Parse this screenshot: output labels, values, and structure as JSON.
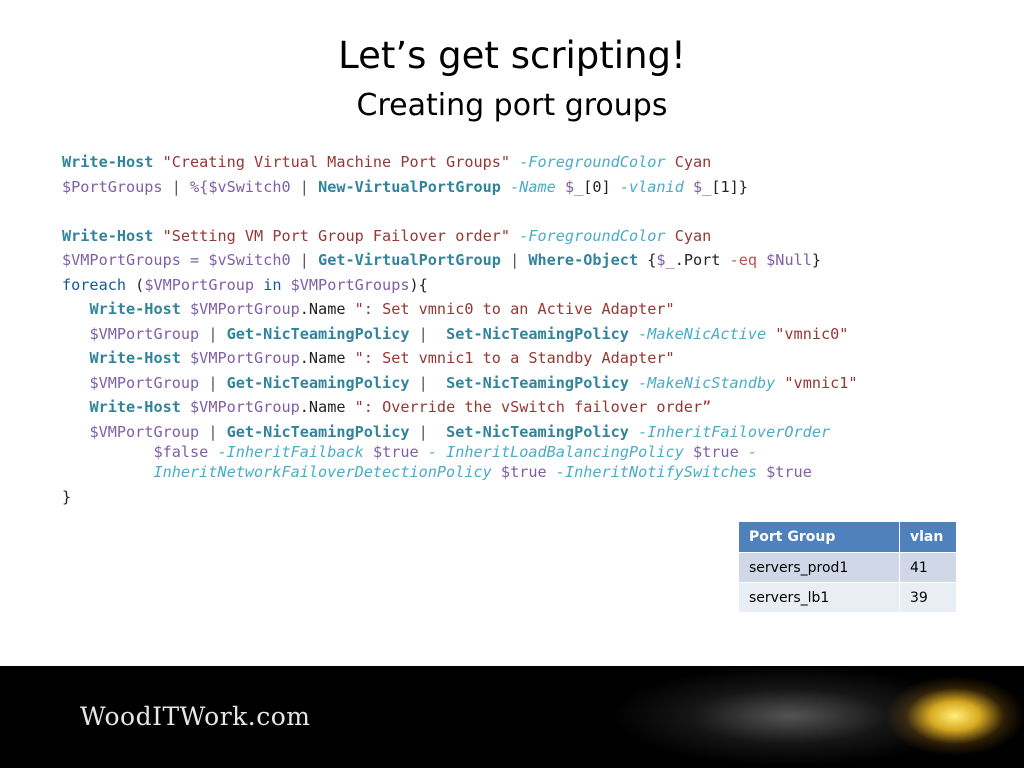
{
  "slide": {
    "title": "Let’s get scripting!",
    "subtitle": "Creating port groups"
  },
  "code": {
    "lines": [
      [
        [
          "cmd",
          "Write-Host"
        ],
        [
          "plain",
          " "
        ],
        [
          "str",
          "\"Creating Virtual Machine Port Groups\""
        ],
        [
          "plain",
          " "
        ],
        [
          "par",
          "-ForegroundColor"
        ],
        [
          "plain",
          " "
        ],
        [
          "str",
          "Cyan"
        ]
      ],
      [
        [
          "var",
          "$PortGroups"
        ],
        [
          "op",
          " | "
        ],
        [
          "var",
          "%{"
        ],
        [
          "var",
          "$vSwitch0"
        ],
        [
          "op",
          " | "
        ],
        [
          "cmd",
          "New-VirtualPortGroup"
        ],
        [
          "plain",
          " "
        ],
        [
          "par",
          "-Name"
        ],
        [
          "plain",
          " "
        ],
        [
          "var",
          "$_"
        ],
        [
          "plain",
          "[0] "
        ],
        [
          "par",
          "-vlanid"
        ],
        [
          "plain",
          " "
        ],
        [
          "var",
          "$_"
        ],
        [
          "plain",
          "[1]}"
        ]
      ],
      [],
      [
        [
          "cmd",
          "Write-Host"
        ],
        [
          "plain",
          " "
        ],
        [
          "str",
          "\"Setting VM Port Group Failover order\""
        ],
        [
          "plain",
          " "
        ],
        [
          "par",
          "-ForegroundColor"
        ],
        [
          "plain",
          " "
        ],
        [
          "str",
          "Cyan"
        ]
      ],
      [
        [
          "var",
          "$VMPortGroups"
        ],
        [
          "var",
          " = "
        ],
        [
          "var",
          "$vSwitch0"
        ],
        [
          "op",
          " | "
        ],
        [
          "cmd",
          "Get-VirtualPortGroup"
        ],
        [
          "op",
          " | "
        ],
        [
          "cmd",
          "Where-Object"
        ],
        [
          "plain",
          " {"
        ],
        [
          "var",
          "$_"
        ],
        [
          "plain",
          ".Port "
        ],
        [
          "red",
          "-eq"
        ],
        [
          "plain",
          " "
        ],
        [
          "var",
          "$Null"
        ],
        [
          "plain",
          "}"
        ]
      ],
      [
        [
          "kw",
          "foreach"
        ],
        [
          "plain",
          " ("
        ],
        [
          "var",
          "$VMPortGroup"
        ],
        [
          "kw",
          " in "
        ],
        [
          "var",
          "$VMPortGroups"
        ],
        [
          "plain",
          "){"
        ]
      ],
      [
        [
          "plain",
          "   "
        ],
        [
          "cmd",
          "Write-Host"
        ],
        [
          "plain",
          " "
        ],
        [
          "var",
          "$VMPortGroup"
        ],
        [
          "plain",
          ".Name "
        ],
        [
          "str",
          "\": Set vmnic0 to an Active Adapter\""
        ]
      ],
      [
        [
          "plain",
          "   "
        ],
        [
          "var",
          "$VMPortGroup"
        ],
        [
          "op",
          " | "
        ],
        [
          "cmd",
          "Get-NicTeamingPolicy"
        ],
        [
          "op",
          " |  "
        ],
        [
          "cmd",
          "Set-NicTeamingPolicy"
        ],
        [
          "plain",
          " "
        ],
        [
          "par",
          "-MakeNicActive"
        ],
        [
          "plain",
          " "
        ],
        [
          "str",
          "\"vmnic0\""
        ]
      ],
      [
        [
          "plain",
          "   "
        ],
        [
          "cmd",
          "Write-Host"
        ],
        [
          "plain",
          " "
        ],
        [
          "var",
          "$VMPortGroup"
        ],
        [
          "plain",
          ".Name "
        ],
        [
          "str",
          "\": Set vmnic1 to a Standby Adapter\""
        ]
      ],
      [
        [
          "plain",
          "   "
        ],
        [
          "var",
          "$VMPortGroup"
        ],
        [
          "op",
          " | "
        ],
        [
          "cmd",
          "Get-NicTeamingPolicy"
        ],
        [
          "op",
          " |  "
        ],
        [
          "cmd",
          "Set-NicTeamingPolicy"
        ],
        [
          "plain",
          " "
        ],
        [
          "par",
          "-MakeNicStandby"
        ],
        [
          "plain",
          " "
        ],
        [
          "str",
          "\"vmnic1\""
        ]
      ],
      [
        [
          "plain",
          "   "
        ],
        [
          "cmd",
          "Write-Host"
        ],
        [
          "plain",
          " "
        ],
        [
          "var",
          "$VMPortGroup"
        ],
        [
          "plain",
          ".Name "
        ],
        [
          "str",
          "\": Override the vSwitch failover order”"
        ]
      ],
      [
        [
          "plain",
          "   "
        ],
        [
          "var",
          "$VMPortGroup"
        ],
        [
          "op",
          " | "
        ],
        [
          "cmd",
          "Get-NicTeamingPolicy"
        ],
        [
          "op",
          " |  "
        ],
        [
          "cmd",
          "Set-NicTeamingPolicy"
        ],
        [
          "plain",
          " "
        ],
        [
          "par",
          "-InheritFailoverOrder"
        ]
      ],
      [
        [
          "plain",
          "          "
        ],
        [
          "var",
          "$false"
        ],
        [
          "plain",
          " "
        ],
        [
          "par",
          "-InheritFailback"
        ],
        [
          "plain",
          " "
        ],
        [
          "var",
          "$true"
        ],
        [
          "plain",
          " "
        ],
        [
          "par",
          "- InheritLoadBalancingPolicy"
        ],
        [
          "plain",
          " "
        ],
        [
          "var",
          "$true"
        ],
        [
          "plain",
          " "
        ],
        [
          "par",
          "-"
        ]
      ],
      [
        [
          "plain",
          "          "
        ],
        [
          "par",
          "InheritNetworkFailoverDetectionPolicy"
        ],
        [
          "plain",
          " "
        ],
        [
          "var",
          "$true"
        ],
        [
          "plain",
          " "
        ],
        [
          "par",
          "-InheritNotifySwitches"
        ],
        [
          "plain",
          " "
        ],
        [
          "var",
          "$true"
        ]
      ],
      [
        [
          "plain",
          "}"
        ]
      ]
    ]
  },
  "table": {
    "headers": [
      "Port Group",
      "vlan"
    ],
    "rows": [
      [
        "servers_prod1",
        "41"
      ],
      [
        "servers_lb1",
        "39"
      ]
    ]
  },
  "footer": {
    "logo_text": "WoodITWork.com"
  }
}
